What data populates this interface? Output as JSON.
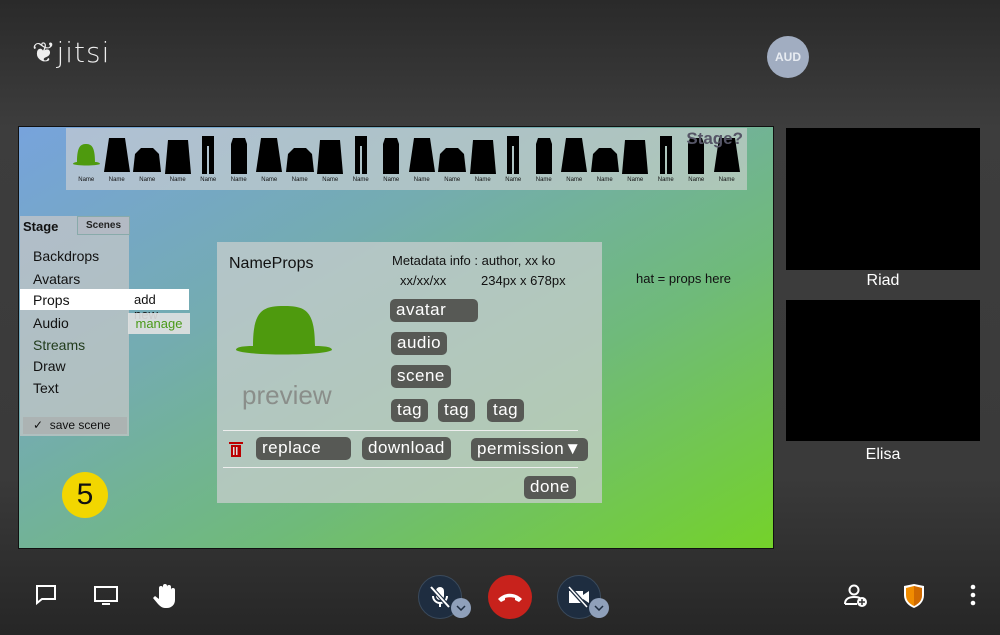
{
  "header": {
    "logo": "jitsi",
    "avatar_initials": "AUD"
  },
  "stage": {
    "wardrobe": {
      "items": [
        "Name",
        "Name",
        "Name",
        "Name",
        "Name",
        "Name",
        "Name",
        "Name",
        "Name",
        "Name",
        "Name",
        "Name",
        "Name",
        "Name",
        "Name",
        "Name",
        "Name",
        "Name",
        "Name",
        "Name",
        "Name",
        "Name"
      ],
      "logo": "Stage?"
    },
    "menu": {
      "tabs": [
        "Stage",
        "Scenes"
      ],
      "items": [
        "Backdrops",
        "Avatars",
        "Props",
        "Audio",
        "Streams",
        "Draw",
        "Text"
      ],
      "submenu": [
        "add new",
        "manage"
      ],
      "save": "save scene",
      "save_icon": "✓"
    },
    "dialog": {
      "title": "NameProps",
      "meta1": "Metadata info : author,   xx ko",
      "meta2_date": "xx/xx/xx",
      "meta2_size": "234px x 678px",
      "preview": "preview",
      "buttons": [
        "avatar",
        "audio",
        "scene"
      ],
      "tags": [
        "tag",
        "tag",
        "tag"
      ],
      "replace": "replace",
      "download": "download",
      "permission": "permission▼",
      "done": "done"
    },
    "hint": "hat = props here",
    "badge": "5",
    "colors": {
      "hat": "#4e9a0e",
      "badge": "#f2d600"
    }
  },
  "participants": [
    "Riad",
    "Elisa"
  ],
  "toolbar": {
    "left": [
      "chat-icon",
      "screenshare-icon",
      "raise-hand-icon"
    ],
    "center": [
      "mic-muted-icon",
      "hangup-icon",
      "camera-off-icon"
    ],
    "right": [
      "invite-icon",
      "security-shield-icon",
      "more-icon"
    ],
    "hangup_color": "#c8221c",
    "shield_color": "#f08c00"
  }
}
